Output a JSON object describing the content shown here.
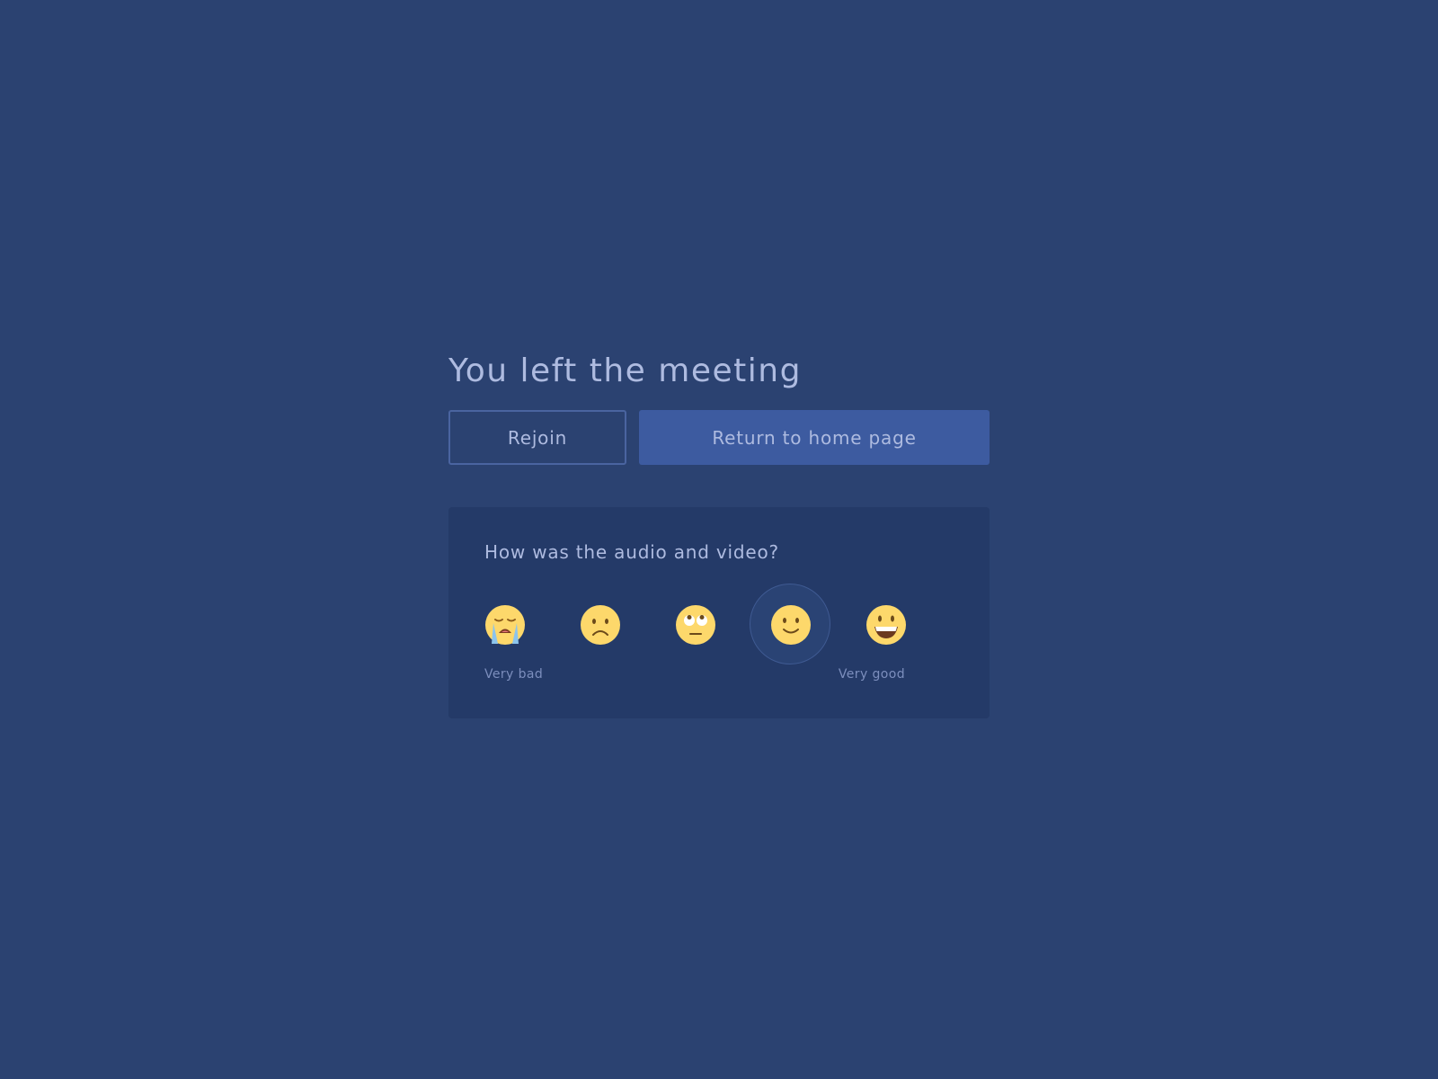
{
  "header": {
    "title": "You left the meeting"
  },
  "actions": {
    "rejoin_label": "Rejoin",
    "home_label": "Return to home page"
  },
  "feedback": {
    "question": "How was the audio and video?",
    "options": [
      {
        "icon": "crying-face-icon",
        "value": 1
      },
      {
        "icon": "frowning-face-icon",
        "value": 2
      },
      {
        "icon": "eye-roll-face-icon",
        "value": 3
      },
      {
        "icon": "slightly-smiling-face-icon",
        "value": 4
      },
      {
        "icon": "grinning-face-icon",
        "value": 5
      }
    ],
    "selected_value": 4,
    "low_label": "Very bad",
    "high_label": "Very good"
  },
  "colors": {
    "background": "#2b4271",
    "card": "#243a68",
    "primary_button": "#3d5ba0",
    "text": "#aebbe0",
    "muted_text": "#7c8ebd",
    "emoji_face": "#fdd86b"
  }
}
